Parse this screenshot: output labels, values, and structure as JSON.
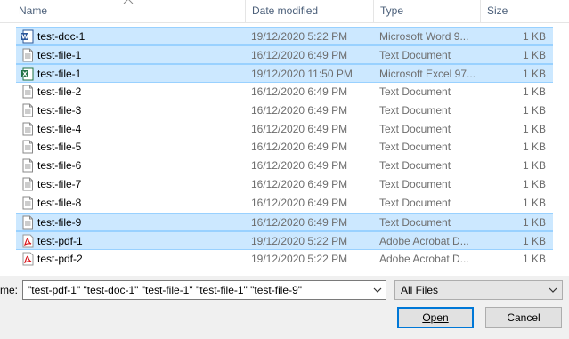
{
  "columns": {
    "name": "Name",
    "date": "Date modified",
    "type": "Type",
    "size": "Size"
  },
  "files": [
    {
      "name": "test-doc-1",
      "date": "19/12/2020 5:22 PM",
      "type": "Microsoft Word 9...",
      "size": "1 KB",
      "icon": "word-doc-icon",
      "selected": true
    },
    {
      "name": "test-file-1",
      "date": "16/12/2020 6:49 PM",
      "type": "Text Document",
      "size": "1 KB",
      "icon": "text-file-icon",
      "selected": true
    },
    {
      "name": "test-file-1",
      "date": "19/12/2020 11:50 PM",
      "type": "Microsoft Excel 97...",
      "size": "1 KB",
      "icon": "excel-file-icon",
      "selected": true
    },
    {
      "name": "test-file-2",
      "date": "16/12/2020 6:49 PM",
      "type": "Text Document",
      "size": "1 KB",
      "icon": "text-file-icon",
      "selected": false
    },
    {
      "name": "test-file-3",
      "date": "16/12/2020 6:49 PM",
      "type": "Text Document",
      "size": "1 KB",
      "icon": "text-file-icon",
      "selected": false
    },
    {
      "name": "test-file-4",
      "date": "16/12/2020 6:49 PM",
      "type": "Text Document",
      "size": "1 KB",
      "icon": "text-file-icon",
      "selected": false
    },
    {
      "name": "test-file-5",
      "date": "16/12/2020 6:49 PM",
      "type": "Text Document",
      "size": "1 KB",
      "icon": "text-file-icon",
      "selected": false
    },
    {
      "name": "test-file-6",
      "date": "16/12/2020 6:49 PM",
      "type": "Text Document",
      "size": "1 KB",
      "icon": "text-file-icon",
      "selected": false
    },
    {
      "name": "test-file-7",
      "date": "16/12/2020 6:49 PM",
      "type": "Text Document",
      "size": "1 KB",
      "icon": "text-file-icon",
      "selected": false
    },
    {
      "name": "test-file-8",
      "date": "16/12/2020 6:49 PM",
      "type": "Text Document",
      "size": "1 KB",
      "icon": "text-file-icon",
      "selected": false
    },
    {
      "name": "test-file-9",
      "date": "16/12/2020 6:49 PM",
      "type": "Text Document",
      "size": "1 KB",
      "icon": "text-file-icon",
      "selected": true
    },
    {
      "name": "test-pdf-1",
      "date": "19/12/2020 5:22 PM",
      "type": "Adobe Acrobat D...",
      "size": "1 KB",
      "icon": "pdf-file-icon",
      "selected": true
    },
    {
      "name": "test-pdf-2",
      "date": "19/12/2020 5:22 PM",
      "type": "Adobe Acrobat D...",
      "size": "1 KB",
      "icon": "pdf-file-icon",
      "selected": false
    }
  ],
  "filename": {
    "label": "me:",
    "value": "\"test-pdf-1\" \"test-doc-1\" \"test-file-1\" \"test-file-1\" \"test-file-9\""
  },
  "filetype": {
    "selected": "All Files"
  },
  "buttons": {
    "open": "Open",
    "cancel": "Cancel"
  },
  "colors": {
    "selection": "#cce8ff",
    "selection_border": "#99d1ff",
    "header_text": "#4c607a",
    "focus": "#0078d7"
  }
}
